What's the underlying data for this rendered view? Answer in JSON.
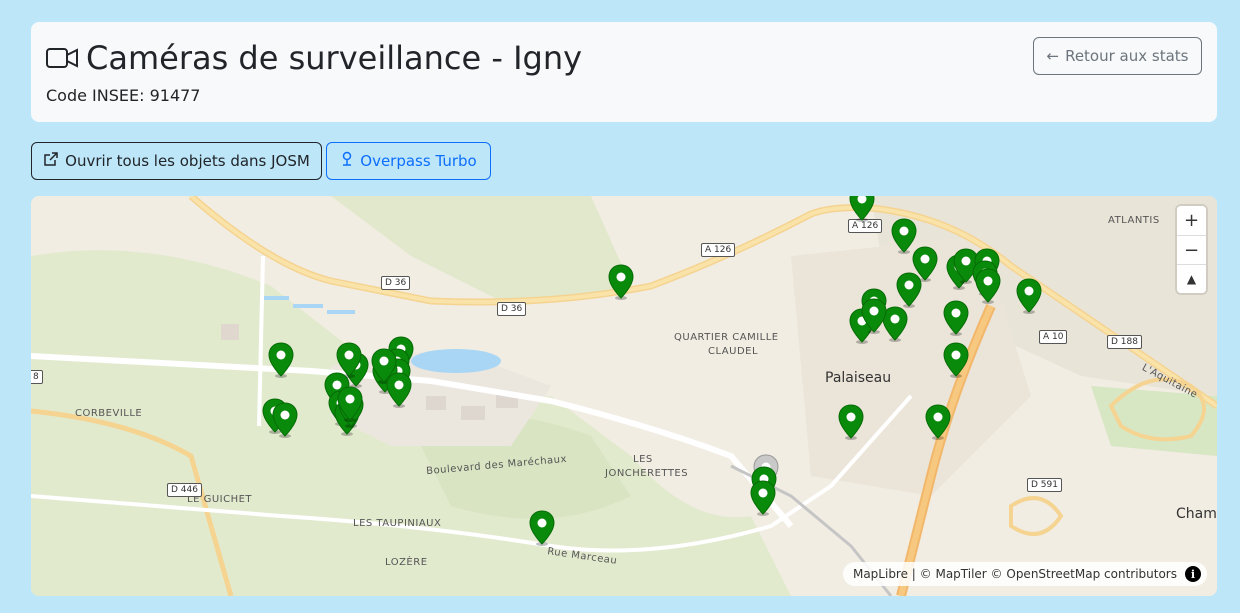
{
  "header": {
    "title": "Caméras de surveillance - Igny",
    "insee": "Code INSEE: 91477",
    "back_label": "Retour aux stats"
  },
  "actions": {
    "josm_label": "Ouvrir tous les objets dans JOSM",
    "overpass_label": "Overpass Turbo"
  },
  "map": {
    "places": [
      {
        "name": "CORBEVILLE",
        "type": "locality"
      },
      {
        "name": "LE GUICHET",
        "type": "locality"
      },
      {
        "name": "LES TAUPINIAUX",
        "type": "locality"
      },
      {
        "name": "LOZÈRE",
        "type": "locality"
      },
      {
        "name": "QUARTIER CAMILLE",
        "type": "locality"
      },
      {
        "name": "CLAUDEL",
        "type": "locality"
      },
      {
        "name": "LES",
        "type": "locality"
      },
      {
        "name": "JONCHERETTES",
        "type": "locality"
      },
      {
        "name": "ATLANTIS",
        "type": "locality"
      },
      {
        "name": "Palaiseau",
        "type": "city"
      },
      {
        "name": "Cham",
        "type": "city"
      },
      {
        "name": "Boulevard des Maréchaux",
        "type": "street"
      },
      {
        "name": "Rue Marceau",
        "type": "street"
      },
      {
        "name": "L'Aquitaine",
        "type": "street"
      }
    ],
    "roads": [
      "D 36",
      "D 36",
      "A 126",
      "A 126",
      "A 10",
      "D 188",
      "D 446",
      "D 591",
      "8"
    ],
    "marker_color": "#0a8a0a",
    "marker_count": 38,
    "zoom_in": "+",
    "zoom_out": "−",
    "compass": "▲",
    "attribution": "MapLibre | © MapTiler © OpenStreetMap contributors",
    "info": "i"
  }
}
